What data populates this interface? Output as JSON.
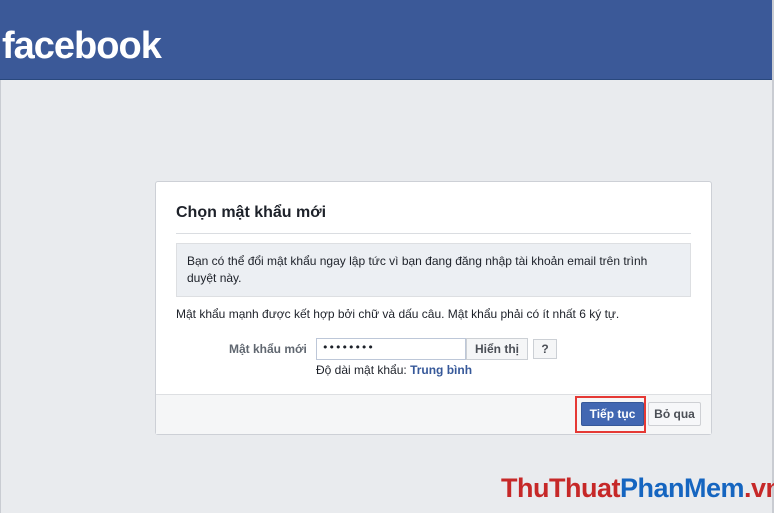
{
  "header": {
    "logo_text": "facebook"
  },
  "form": {
    "title": "Chọn mật khẩu mới",
    "notice": "Bạn có thể đổi mật khẩu ngay lập tức vì bạn đang đăng nhập tài khoản email trên trình duyệt này.",
    "hint": "Mật khẩu mạnh được kết hợp bởi chữ và dấu câu. Mật khẩu phải có ít nhất 6 ký tự.",
    "password_label": "Mật khẩu mới",
    "password_value": "••••••••",
    "show_label": "Hiển thị",
    "help_label": "?",
    "strength_label": "Độ dài mật khẩu:",
    "strength_value": "Trung bình",
    "continue_label": "Tiếp tục",
    "skip_label": "Bỏ qua"
  },
  "watermark": {
    "part1": "ThuThuat",
    "part2": "PhanMem",
    "part3": ".vn"
  },
  "colors": {
    "brand": "#3b5998",
    "primary_button": "#4267b2",
    "highlight": "#e53935",
    "link": "#365899"
  }
}
